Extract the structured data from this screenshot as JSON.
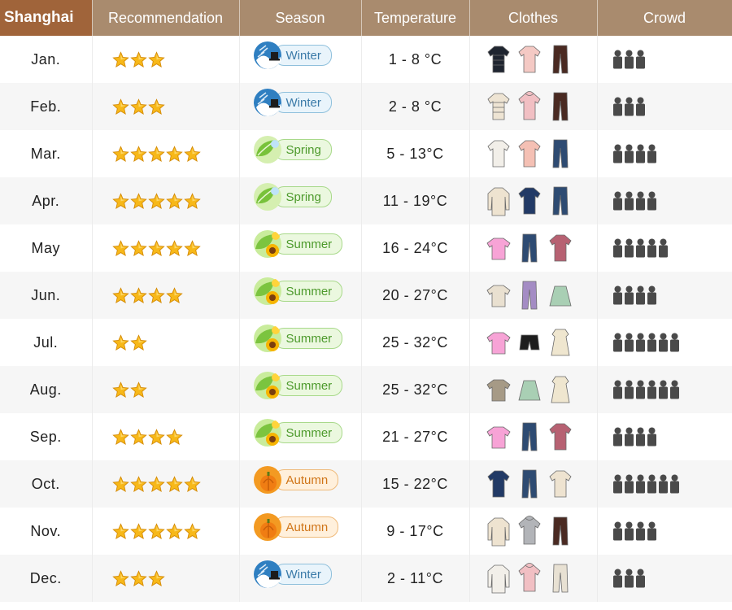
{
  "header": {
    "city": "Shanghai",
    "recommendation": "Recommendation",
    "season": "Season",
    "temperature": "Temperature",
    "clothes": "Clothes",
    "crowd": "Crowd"
  },
  "colors": {
    "header_bg": "#a98b6e",
    "city_header_bg": "#a0643a",
    "star": "#f7b819",
    "people": "#4a4a4a"
  },
  "rows": [
    {
      "month": "Jan.",
      "stars": 3,
      "season": "Winter",
      "season_key": "winter",
      "temp": "1 - 8 °C",
      "clothes": [
        {
          "icon": "puffer-jacket-icon",
          "color": "#1f2530"
        },
        {
          "icon": "sweater-icon",
          "color": "#f4c9c4"
        },
        {
          "icon": "trousers-icon",
          "color": "#4a2a22"
        }
      ],
      "crowd": 3
    },
    {
      "month": "Feb.",
      "stars": 3,
      "season": "Winter",
      "season_key": "winter",
      "temp": "2 - 8 °C",
      "clothes": [
        {
          "icon": "puffer-jacket-icon",
          "color": "#eee4d3"
        },
        {
          "icon": "hoodie-icon",
          "color": "#f1bfc3"
        },
        {
          "icon": "trousers-icon",
          "color": "#4a2a22"
        }
      ],
      "crowd": 3
    },
    {
      "month": "Mar.",
      "stars": 5,
      "season": "Spring",
      "season_key": "spring",
      "temp": "5 - 13°C",
      "clothes": [
        {
          "icon": "jacket-icon",
          "color": "#f2efe9"
        },
        {
          "icon": "sweater-icon",
          "color": "#f4c0b4"
        },
        {
          "icon": "jeans-icon",
          "color": "#2e4b72"
        }
      ],
      "crowd": 4
    },
    {
      "month": "Apr.",
      "stars": 5,
      "season": "Spring",
      "season_key": "spring",
      "temp": "11 - 19°C",
      "clothes": [
        {
          "icon": "trench-coat-icon",
          "color": "#eee3d0"
        },
        {
          "icon": "sweatshirt-icon",
          "color": "#223a66"
        },
        {
          "icon": "jeans-icon",
          "color": "#2e4b72"
        }
      ],
      "crowd": 4
    },
    {
      "month": "May",
      "stars": 5,
      "season": "Summer",
      "season_key": "summer",
      "temp": "16 - 24°C",
      "clothes": [
        {
          "icon": "tshirt-icon",
          "color": "#f7a3d6"
        },
        {
          "icon": "jeans-icon",
          "color": "#2e4b72"
        },
        {
          "icon": "shirt-icon",
          "color": "#b76172"
        }
      ],
      "crowd": 5
    },
    {
      "month": "Jun.",
      "stars": 4,
      "season": "Summer",
      "season_key": "summer",
      "temp": "20 - 27°C",
      "clothes": [
        {
          "icon": "polo-shirt-icon",
          "color": "#e9e0d0"
        },
        {
          "icon": "trousers-icon",
          "color": "#a48cc4"
        },
        {
          "icon": "skirt-icon",
          "color": "#a9cfb4"
        }
      ],
      "crowd": 4
    },
    {
      "month": "Jul.",
      "stars": 2,
      "season": "Summer",
      "season_key": "summer",
      "temp": "25 - 32°C",
      "clothes": [
        {
          "icon": "tshirt-icon",
          "color": "#f7a3d6"
        },
        {
          "icon": "shorts-icon",
          "color": "#1d1d1d"
        },
        {
          "icon": "dress-icon",
          "color": "#efe6cf"
        }
      ],
      "crowd": 6
    },
    {
      "month": "Aug.",
      "stars": 2,
      "season": "Summer",
      "season_key": "summer",
      "temp": "25 - 32°C",
      "clothes": [
        {
          "icon": "tshirt-icon",
          "color": "#a69a86"
        },
        {
          "icon": "skirt-icon",
          "color": "#a9cfb4"
        },
        {
          "icon": "dress-icon",
          "color": "#efe6cf"
        }
      ],
      "crowd": 6
    },
    {
      "month": "Sep.",
      "stars": 4,
      "season": "Summer",
      "season_key": "summer",
      "temp": "21 - 27°C",
      "clothes": [
        {
          "icon": "tshirt-icon",
          "color": "#f7a3d6"
        },
        {
          "icon": "jeans-icon",
          "color": "#2e4b72"
        },
        {
          "icon": "shirt-icon",
          "color": "#b76172"
        }
      ],
      "crowd": 4
    },
    {
      "month": "Oct.",
      "stars": 5,
      "season": "Autumn",
      "season_key": "autumn",
      "temp": "15 - 22°C",
      "clothes": [
        {
          "icon": "sweatshirt-icon",
          "color": "#223a66"
        },
        {
          "icon": "jeans-icon",
          "color": "#2e4b72"
        },
        {
          "icon": "jacket-icon",
          "color": "#eee3d0"
        }
      ],
      "crowd": 6
    },
    {
      "month": "Nov.",
      "stars": 5,
      "season": "Autumn",
      "season_key": "autumn",
      "temp": "9 - 17°C",
      "clothes": [
        {
          "icon": "trench-coat-icon",
          "color": "#eee3d0"
        },
        {
          "icon": "hoodie-icon",
          "color": "#b2b4b8"
        },
        {
          "icon": "trousers-icon",
          "color": "#4a2a22"
        }
      ],
      "crowd": 4
    },
    {
      "month": "Dec.",
      "stars": 3,
      "season": "Winter",
      "season_key": "winter",
      "temp": "2 - 11°C",
      "clothes": [
        {
          "icon": "long-coat-icon",
          "color": "#f2efe9"
        },
        {
          "icon": "hoodie-icon",
          "color": "#f1bfc3"
        },
        {
          "icon": "sweatpants-icon",
          "color": "#e8e1d3"
        }
      ],
      "crowd": 3
    }
  ]
}
